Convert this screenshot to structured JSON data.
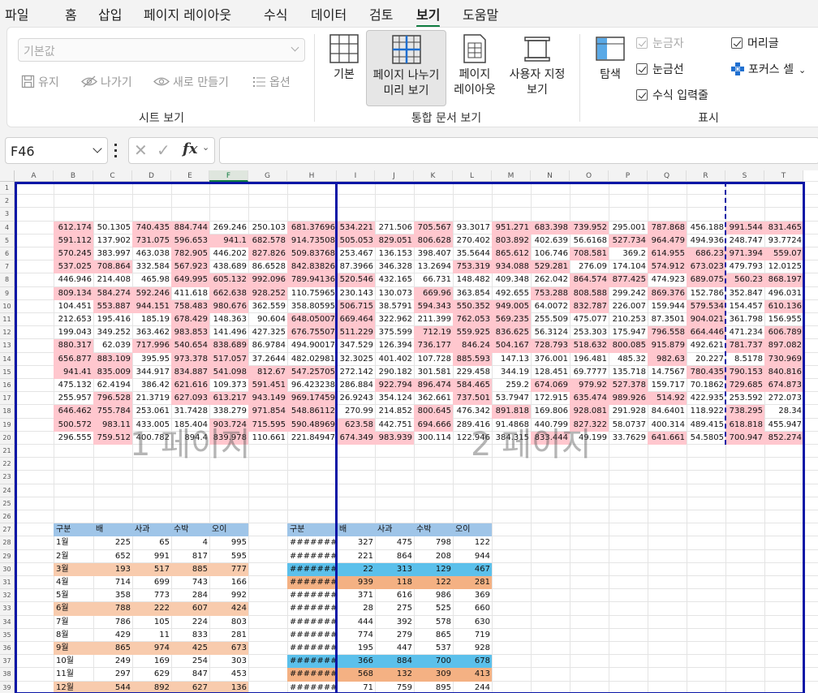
{
  "menu": [
    "파일",
    "홈",
    "삽입",
    "페이지 레이아웃",
    "수식",
    "데이터",
    "검토",
    "보기",
    "도움말"
  ],
  "menu_active_index": 7,
  "ribbon": {
    "sheet_view": {
      "dropdown_value": "기본값",
      "buttons": [
        "유지",
        "나가기",
        "새로 만들기",
        "옵션"
      ],
      "label": "시트 보기"
    },
    "workbook_views": {
      "buttons": [
        "기본",
        "페이지 나누기\n미리 보기",
        "페이지\n레이아웃",
        "사용자 지정\n보기"
      ],
      "selected_index": 1,
      "label": "통합 문서 보기"
    },
    "show": {
      "navigate": "탐색",
      "checks": [
        {
          "label": "눈금자",
          "checked": true,
          "disabled": true
        },
        {
          "label": "눈금선",
          "checked": true,
          "disabled": false
        },
        {
          "label": "수식 입력줄",
          "checked": true,
          "disabled": false
        },
        {
          "label": "머리글",
          "checked": true,
          "disabled": false
        }
      ],
      "focus_cell": "포커스 셀",
      "label": "표시"
    }
  },
  "formula_bar": {
    "name_box": "F46",
    "fx": "fx",
    "formula": ""
  },
  "columns": [
    "A",
    "B",
    "C",
    "D",
    "E",
    "F",
    "G",
    "H",
    "I",
    "J",
    "K",
    "L",
    "M",
    "N",
    "O",
    "P",
    "Q",
    "R",
    "S",
    "T"
  ],
  "active_column": "F",
  "rows": [
    "1",
    "2",
    "3",
    "4",
    "5",
    "6",
    "7",
    "8",
    "9",
    "10",
    "11",
    "12",
    "13",
    "14",
    "15",
    "16",
    "17",
    "18",
    "19",
    "20",
    "21",
    "22",
    "23",
    "24",
    "25",
    "26",
    "27",
    "28",
    "29",
    "30",
    "31",
    "32",
    "33",
    "34",
    "35",
    "36",
    "37",
    "38",
    "39"
  ],
  "page_labels": [
    "1 페이지",
    "2 페이지"
  ],
  "colors": {
    "pink": "#ffc7ce",
    "header_blue": "#9fc5e8",
    "orange": "#f8cbad",
    "cyan": "#5bc0eb",
    "salmon": "#f4b183",
    "page_border": "#0a16a6",
    "green": "#107c41"
  },
  "data_grid": [
    [
      "612.174",
      "50.1305",
      "740.435",
      "884.744",
      "269.246",
      "250.103",
      "681.37696",
      "534.221",
      "271.506",
      "705.567",
      "93.3017",
      "951.271",
      "683.398",
      "739.952",
      "295.001",
      "787.868",
      "456.188",
      "991.544",
      "831.465"
    ],
    [
      "591.112",
      "137.902",
      "731.075",
      "596.653",
      "941.1",
      "682.578",
      "914.73508",
      "505.053",
      "829.051",
      "806.628",
      "270.402",
      "803.892",
      "402.639",
      "56.6168",
      "527.734",
      "964.479",
      "494.936",
      "248.747",
      "93.7724"
    ],
    [
      "570.245",
      "383.997",
      "463.038",
      "782.905",
      "446.202",
      "827.826",
      "509.83768",
      "253.467",
      "136.153",
      "398.407",
      "35.5644",
      "865.612",
      "106.746",
      "708.581",
      "369.2",
      "614.955",
      "686.23",
      "971.394",
      "559.07"
    ],
    [
      "537.025",
      "708.864",
      "332.584",
      "567.923",
      "438.689",
      "86.6528",
      "842.83826",
      "87.3966",
      "346.328",
      "13.2694",
      "753.319",
      "934.088",
      "529.281",
      "276.09",
      "174.104",
      "574.912",
      "673.023",
      "479.793",
      "12.0125"
    ],
    [
      "446.946",
      "214.408",
      "465.98",
      "649.995",
      "605.132",
      "992.096",
      "789.94136",
      "520.546",
      "432.165",
      "66.731",
      "148.482",
      "409.348",
      "262.042",
      "864.574",
      "877.425",
      "474.923",
      "689.075",
      "560.23",
      "868.197"
    ],
    [
      "809.134",
      "584.274",
      "592.246",
      "411.618",
      "662.638",
      "928.252",
      "110.75965",
      "230.143",
      "130.073",
      "669.96",
      "363.854",
      "492.655",
      "753.288",
      "808.588",
      "299.242",
      "869.376",
      "152.786",
      "352.847",
      "496.031"
    ],
    [
      "104.451",
      "553.887",
      "944.151",
      "758.483",
      "980.676",
      "362.559",
      "358.80595",
      "506.715",
      "38.5791",
      "594.343",
      "550.352",
      "949.005",
      "64.0072",
      "832.787",
      "226.007",
      "159.944",
      "579.534",
      "154.457",
      "610.136"
    ],
    [
      "212.653",
      "195.416",
      "185.19",
      "678.429",
      "148.363",
      "90.604",
      "648.05007",
      "669.464",
      "322.962",
      "211.399",
      "762.053",
      "569.235",
      "255.509",
      "475.077",
      "210.253",
      "87.3501",
      "904.021",
      "361.798",
      "156.955"
    ],
    [
      "199.043",
      "349.252",
      "363.462",
      "983.853",
      "141.496",
      "427.325",
      "676.75507",
      "511.229",
      "375.599",
      "712.19",
      "559.925",
      "836.625",
      "56.3124",
      "253.303",
      "175.947",
      "796.558",
      "664.446",
      "471.234",
      "606.789"
    ],
    [
      "880.317",
      "62.039",
      "717.996",
      "540.654",
      "838.689",
      "86.9784",
      "494.90017",
      "347.529",
      "126.394",
      "736.177",
      "846.24",
      "504.167",
      "728.793",
      "518.632",
      "800.085",
      "915.879",
      "492.621",
      "781.737",
      "897.082"
    ],
    [
      "656.877",
      "883.109",
      "395.95",
      "973.378",
      "517.057",
      "37.2644",
      "482.02981",
      "32.3025",
      "401.402",
      "107.728",
      "885.593",
      "147.13",
      "376.001",
      "196.481",
      "485.32",
      "982.63",
      "20.227",
      "8.5178",
      "730.969"
    ],
    [
      "941.41",
      "835.009",
      "344.917",
      "834.887",
      "541.098",
      "812.67",
      "547.25705",
      "272.142",
      "290.182",
      "301.581",
      "229.458",
      "344.19",
      "128.451",
      "69.7777",
      "135.718",
      "14.7567",
      "780.435",
      "790.153",
      "840.816"
    ],
    [
      "475.132",
      "62.4194",
      "386.42",
      "621.616",
      "109.373",
      "591.451",
      "96.423238",
      "286.884",
      "922.794",
      "896.474",
      "584.465",
      "259.2",
      "674.069",
      "979.92",
      "527.378",
      "159.717",
      "70.1862",
      "729.685",
      "674.873"
    ],
    [
      "255.957",
      "796.528",
      "21.3719",
      "627.093",
      "613.217",
      "943.149",
      "969.17459",
      "26.9243",
      "354.124",
      "362.661",
      "737.501",
      "53.7947",
      "172.915",
      "635.474",
      "989.926",
      "514.92",
      "422.935",
      "253.592",
      "272.073"
    ],
    [
      "646.462",
      "755.784",
      "253.061",
      "31.7428",
      "338.279",
      "971.854",
      "548.86112",
      "270.99",
      "214.852",
      "800.645",
      "476.342",
      "891.818",
      "169.806",
      "928.081",
      "291.928",
      "84.6401",
      "118.922",
      "738.295",
      "28.34"
    ],
    [
      "500.572",
      "983.11",
      "433.005",
      "185.404",
      "903.724",
      "715.595",
      "590.48969",
      "623.58",
      "442.751",
      "694.666",
      "289.416",
      "91.4868",
      "440.799",
      "827.322",
      "58.0737",
      "400.314",
      "489.415",
      "618.818",
      "455.947"
    ],
    [
      "296.555",
      "759.512",
      "400.782",
      "894.4",
      "839.978",
      "110.661",
      "221.84947",
      "674.349",
      "983.939",
      "300.114",
      "122.946",
      "384.315",
      "833.444",
      "49.199",
      "33.7629",
      "641.661",
      "54.5805",
      "700.947",
      "852.274"
    ]
  ],
  "pink_cells": [
    [
      1,
      0,
      1,
      1,
      0,
      0,
      1,
      1,
      0,
      1,
      0,
      1,
      1,
      1,
      0,
      1,
      0,
      1,
      1
    ],
    [
      1,
      0,
      1,
      1,
      1,
      1,
      1,
      1,
      1,
      1,
      0,
      1,
      0,
      0,
      1,
      1,
      0,
      0,
      0
    ],
    [
      1,
      0,
      0,
      1,
      0,
      1,
      1,
      0,
      0,
      0,
      0,
      1,
      0,
      1,
      0,
      1,
      1,
      1,
      1
    ],
    [
      1,
      1,
      0,
      1,
      0,
      0,
      1,
      0,
      0,
      0,
      1,
      1,
      1,
      0,
      0,
      1,
      1,
      0,
      0
    ],
    [
      0,
      0,
      0,
      1,
      1,
      1,
      1,
      1,
      0,
      0,
      0,
      0,
      0,
      1,
      1,
      0,
      1,
      1,
      1
    ],
    [
      1,
      1,
      1,
      0,
      1,
      1,
      0,
      0,
      0,
      1,
      0,
      0,
      1,
      1,
      0,
      1,
      0,
      0,
      0
    ],
    [
      0,
      1,
      1,
      1,
      1,
      0,
      0,
      1,
      0,
      1,
      1,
      1,
      0,
      1,
      0,
      0,
      1,
      0,
      1
    ],
    [
      0,
      0,
      0,
      1,
      0,
      0,
      1,
      1,
      0,
      0,
      1,
      1,
      0,
      0,
      0,
      0,
      1,
      0,
      0
    ],
    [
      0,
      0,
      0,
      1,
      0,
      0,
      1,
      1,
      0,
      1,
      1,
      1,
      0,
      0,
      0,
      1,
      1,
      0,
      1
    ],
    [
      1,
      0,
      1,
      1,
      1,
      0,
      0,
      0,
      0,
      1,
      1,
      1,
      1,
      1,
      1,
      1,
      0,
      1,
      1
    ],
    [
      1,
      1,
      0,
      1,
      1,
      0,
      0,
      0,
      0,
      0,
      1,
      0,
      0,
      0,
      0,
      1,
      0,
      0,
      1
    ],
    [
      1,
      1,
      0,
      1,
      1,
      1,
      1,
      0,
      0,
      0,
      0,
      0,
      0,
      0,
      0,
      0,
      1,
      1,
      1
    ],
    [
      0,
      0,
      0,
      1,
      0,
      1,
      0,
      0,
      1,
      1,
      1,
      0,
      1,
      1,
      1,
      0,
      0,
      1,
      1
    ],
    [
      0,
      1,
      0,
      1,
      1,
      1,
      1,
      0,
      0,
      0,
      1,
      0,
      0,
      1,
      1,
      1,
      0,
      0,
      0
    ],
    [
      1,
      1,
      0,
      0,
      0,
      1,
      1,
      0,
      0,
      1,
      0,
      1,
      0,
      1,
      0,
      0,
      0,
      1,
      0
    ],
    [
      1,
      1,
      0,
      0,
      1,
      1,
      1,
      1,
      0,
      1,
      0,
      0,
      0,
      1,
      0,
      0,
      0,
      1,
      0
    ],
    [
      0,
      1,
      0,
      0,
      1,
      0,
      0,
      1,
      1,
      0,
      0,
      0,
      1,
      0,
      0,
      1,
      0,
      1,
      1
    ]
  ],
  "table1": {
    "headers": [
      "구분",
      "배",
      "사과",
      "수박",
      "오이"
    ],
    "rows": [
      [
        "1월",
        "225",
        "65",
        "4",
        "995"
      ],
      [
        "2월",
        "652",
        "991",
        "817",
        "595"
      ],
      [
        "3월",
        "193",
        "517",
        "885",
        "777"
      ],
      [
        "4월",
        "714",
        "699",
        "743",
        "166"
      ],
      [
        "5월",
        "358",
        "773",
        "284",
        "992"
      ],
      [
        "6월",
        "788",
        "222",
        "607",
        "424"
      ],
      [
        "7월",
        "786",
        "105",
        "224",
        "803"
      ],
      [
        "8월",
        "429",
        "11",
        "833",
        "281"
      ],
      [
        "9월",
        "865",
        "974",
        "425",
        "673"
      ],
      [
        "10월",
        "249",
        "169",
        "254",
        "303"
      ],
      [
        "11월",
        "297",
        "629",
        "847",
        "453"
      ],
      [
        "12월",
        "544",
        "892",
        "627",
        "136"
      ]
    ],
    "highlight_rows": [
      2,
      5,
      8,
      11
    ]
  },
  "table2": {
    "headers": [
      "구분",
      "배",
      "사과",
      "수박",
      "오이"
    ],
    "rows": [
      [
        "########",
        "327",
        "475",
        "798",
        "122"
      ],
      [
        "########",
        "221",
        "864",
        "208",
        "944"
      ],
      [
        "########",
        "22",
        "313",
        "129",
        "467"
      ],
      [
        "########",
        "939",
        "118",
        "122",
        "281"
      ],
      [
        "########",
        "371",
        "616",
        "986",
        "369"
      ],
      [
        "########",
        "28",
        "275",
        "525",
        "660"
      ],
      [
        "########",
        "444",
        "392",
        "578",
        "630"
      ],
      [
        "########",
        "774",
        "279",
        "865",
        "719"
      ],
      [
        "########",
        "195",
        "447",
        "537",
        "928"
      ],
      [
        "########",
        "366",
        "884",
        "700",
        "678"
      ],
      [
        "########",
        "568",
        "132",
        "309",
        "413"
      ],
      [
        "########",
        "71",
        "759",
        "895",
        "244"
      ]
    ],
    "cyan_rows": [
      2,
      9
    ],
    "salmon_rows": [
      3,
      10
    ]
  }
}
